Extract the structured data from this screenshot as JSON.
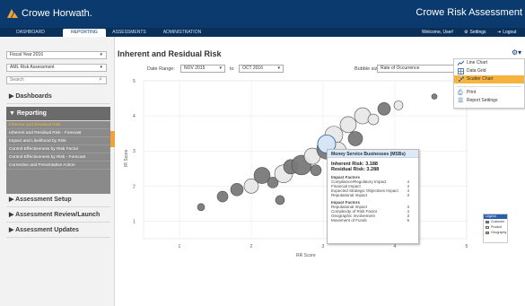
{
  "header": {
    "logo_text": "Crowe Horwath.",
    "app_title": "Crowe Risk Assessment",
    "welcome": "Welcome, User!",
    "settings": "Settings",
    "logout": "Logout"
  },
  "nav": {
    "tabs": [
      "DASHBOARD",
      "REPORTING",
      "ASSESSMENTS",
      "ADMINISTRATION"
    ],
    "active": "REPORTING"
  },
  "sidebar": {
    "fiscal_year": "Fiscal Year 2016",
    "assessment": "AML Risk Assessment",
    "search_placeholder": "Search",
    "sections": {
      "dashboards": "Dashboards",
      "reporting": "Reporting",
      "setup": "Assessment Setup",
      "review": "Assessment Review/Launch",
      "updates": "Assessment Updates"
    },
    "reporting_items": [
      "Inherent and Residual Risk",
      "Inherent and Residual Risk - Forecast",
      "Impact and Likelihood by Risk",
      "Control Effectiveness by Risk Factor",
      "Control Effectiveness by Risk - Forecast",
      "Corrective and Preventative Action"
    ]
  },
  "main": {
    "title": "Inherent and Residual Risk",
    "date_range_label": "Date Range:",
    "date_from": "NOV 2015",
    "to_label": "to",
    "date_to": "OCT 2016",
    "bubble_label": "Bubble size:",
    "bubble_value": "Rate of Occurrence"
  },
  "menu": {
    "items": [
      "Line Chart",
      "Data Grid",
      "Scatter Chart",
      "Print",
      "Report Settings"
    ],
    "highlighted": "Scatter Chart"
  },
  "tooltip": {
    "title": "Money Service Businesses (MSBs)",
    "inherent": "Inherent Risk:  3.188",
    "residual": "Residual Risk:  3.288",
    "group1_title": "Impact Factors",
    "group1": [
      [
        "Compliance/Regulatory Impact",
        "4"
      ],
      [
        "Financial Impact",
        "4"
      ],
      [
        "Expected Strategic Objectives Impact",
        "4"
      ],
      [
        "Reputational Impact",
        "3"
      ]
    ],
    "group2_title": "Impact Factors",
    "group2": [
      [
        "Reputational Impact",
        "3"
      ],
      [
        "Complexity of Risk Factor",
        "4"
      ],
      [
        "Geographic Involvement",
        "3"
      ],
      [
        "Movement of Funds",
        "5"
      ]
    ]
  },
  "legend": {
    "title": "Legend",
    "items": [
      {
        "label": "Customer",
        "color": "#7a7a7a"
      },
      {
        "label": "Product",
        "color": "#e8e8e8"
      },
      {
        "label": "Geography",
        "color": "#f2a23a"
      }
    ]
  },
  "chart_data": {
    "type": "scatter",
    "xlabel": "RR Score",
    "ylabel": "IR Score",
    "xlim": [
      0.5,
      5
    ],
    "ylim": [
      0.5,
      5
    ],
    "x_ticks": [
      1,
      2,
      3,
      4,
      5
    ],
    "y_ticks": [
      1,
      2,
      3,
      4,
      5
    ],
    "points": [
      {
        "x": 1.3,
        "y": 1.4,
        "size": 4,
        "group": "Customer"
      },
      {
        "x": 1.6,
        "y": 1.7,
        "size": 6,
        "group": "Customer"
      },
      {
        "x": 1.8,
        "y": 1.9,
        "size": 7,
        "group": "Customer"
      },
      {
        "x": 2.0,
        "y": 2.0,
        "size": 8,
        "group": "Product"
      },
      {
        "x": 2.15,
        "y": 2.3,
        "size": 9,
        "group": "Customer"
      },
      {
        "x": 2.3,
        "y": 2.1,
        "size": 6,
        "group": "Customer"
      },
      {
        "x": 2.45,
        "y": 2.35,
        "size": 10,
        "group": "Product"
      },
      {
        "x": 2.55,
        "y": 2.55,
        "size": 8,
        "group": "Customer"
      },
      {
        "x": 2.7,
        "y": 2.6,
        "size": 11,
        "group": "Customer"
      },
      {
        "x": 2.85,
        "y": 2.85,
        "size": 9,
        "group": "Product"
      },
      {
        "x": 2.9,
        "y": 2.45,
        "size": 6,
        "group": "Customer"
      },
      {
        "x": 3.05,
        "y": 3.05,
        "size": 11,
        "group": "Customer"
      },
      {
        "x": 3.15,
        "y": 3.45,
        "size": 10,
        "group": "Product"
      },
      {
        "x": 3.2,
        "y": 3.0,
        "size": 10,
        "group": "Product"
      },
      {
        "x": 3.35,
        "y": 3.75,
        "size": 9,
        "group": "Product"
      },
      {
        "x": 3.45,
        "y": 3.35,
        "size": 8,
        "group": "Customer"
      },
      {
        "x": 3.55,
        "y": 4.0,
        "size": 9,
        "group": "Product"
      },
      {
        "x": 3.7,
        "y": 3.9,
        "size": 6,
        "group": "Product"
      },
      {
        "x": 3.85,
        "y": 4.2,
        "size": 7,
        "group": "Customer"
      },
      {
        "x": 4.05,
        "y": 4.3,
        "size": 5,
        "group": "Product"
      },
      {
        "x": 4.55,
        "y": 4.55,
        "size": 3,
        "group": "Customer"
      },
      {
        "x": 2.4,
        "y": 1.6,
        "size": 5,
        "group": "Customer"
      }
    ],
    "highlighted_point": {
      "x": 3.05,
      "y": 3.2,
      "size": 10,
      "group": "Product"
    }
  }
}
